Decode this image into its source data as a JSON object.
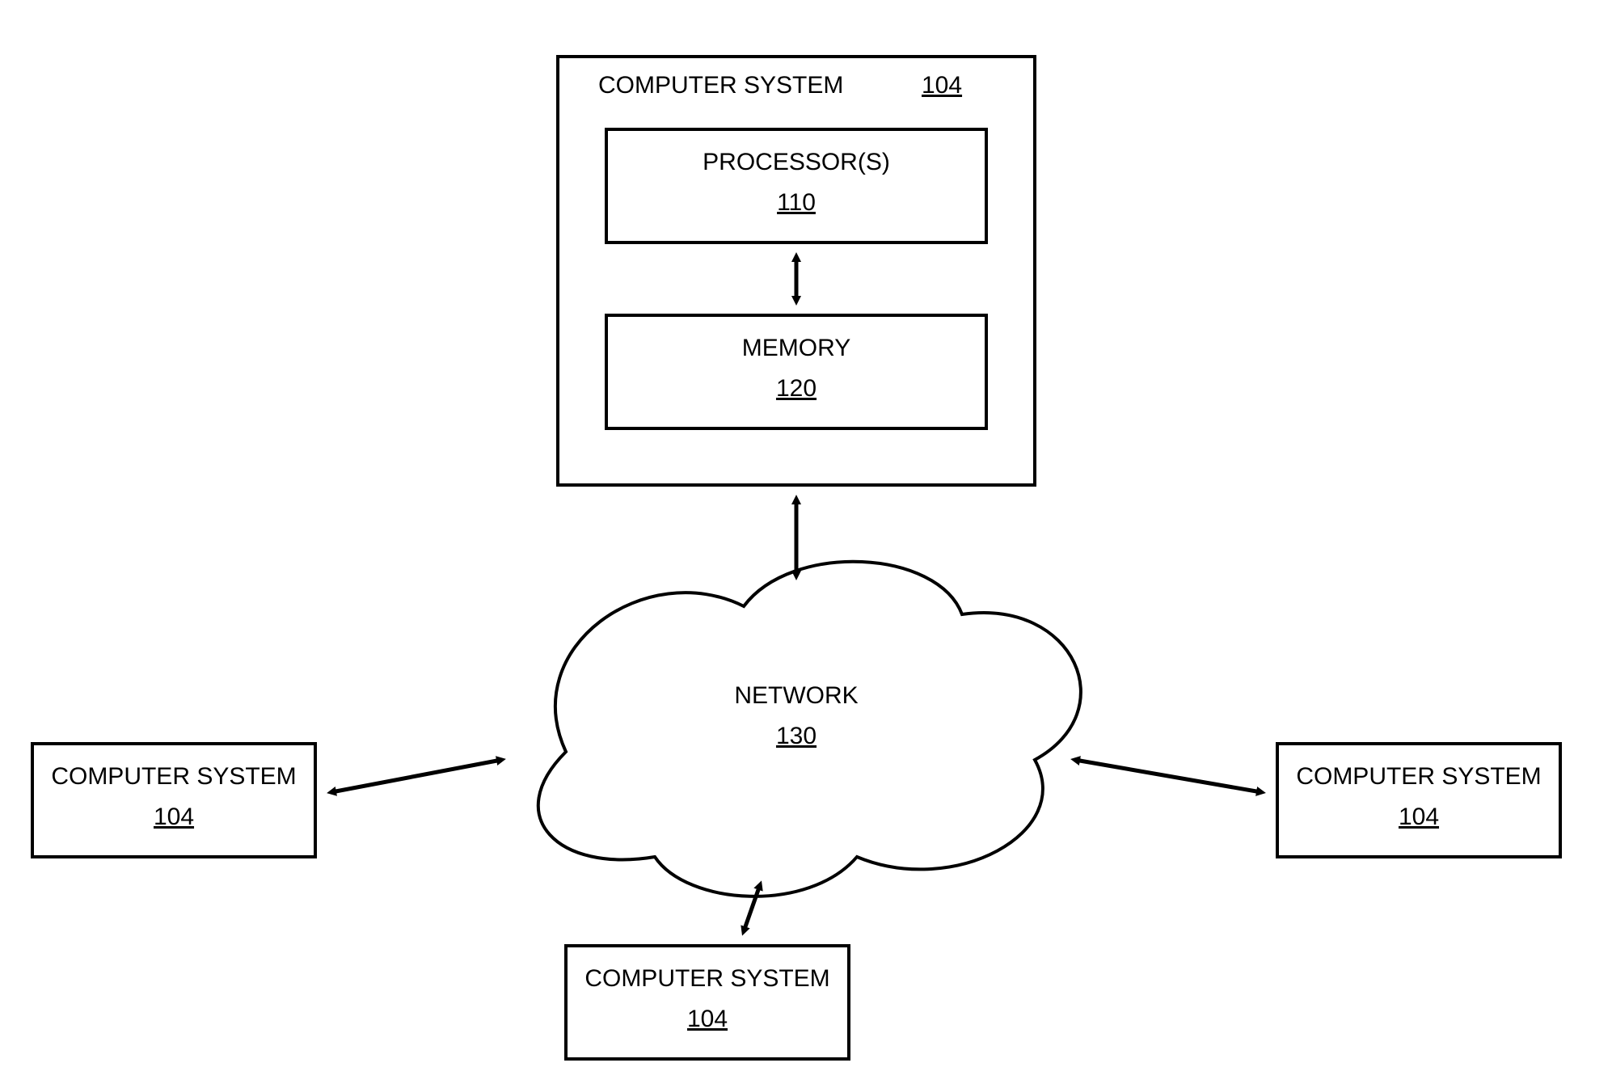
{
  "blocks": {
    "main_system": {
      "label": "COMPUTER SYSTEM",
      "ref": "104"
    },
    "processor": {
      "label": "PROCESSOR(S)",
      "ref": "110"
    },
    "memory": {
      "label": "MEMORY",
      "ref": "120"
    },
    "network": {
      "label": "NETWORK",
      "ref": "130"
    },
    "left_system": {
      "label": "COMPUTER SYSTEM",
      "ref": "104"
    },
    "right_system": {
      "label": "COMPUTER SYSTEM",
      "ref": "104"
    },
    "bottom_system": {
      "label": "COMPUTER SYSTEM",
      "ref": "104"
    }
  }
}
